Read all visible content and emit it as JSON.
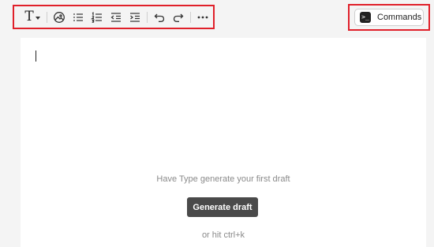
{
  "toolbar": {
    "buttons": [
      {
        "name": "text-style",
        "icon": "text-format-icon",
        "label": "T"
      },
      {
        "name": "image",
        "icon": "image-icon"
      },
      {
        "name": "bullet-list",
        "icon": "bullet-list-icon"
      },
      {
        "name": "numbered-list",
        "icon": "numbered-list-icon"
      },
      {
        "name": "outdent",
        "icon": "outdent-icon"
      },
      {
        "name": "indent",
        "icon": "indent-icon"
      },
      {
        "name": "undo",
        "icon": "undo-icon"
      },
      {
        "name": "redo",
        "icon": "redo-icon"
      },
      {
        "name": "more",
        "icon": "more-icon"
      }
    ]
  },
  "commands": {
    "label": "Commands",
    "icon": "terminal-icon"
  },
  "editor": {
    "prompt": "Have Type generate your first draft",
    "generate_label": "Generate draft",
    "shortcut_hint": "or hit ctrl+k"
  },
  "colors": {
    "highlight_border": "#e0202a",
    "primary_button": "#4a4a4a",
    "background": "#f4f4f4"
  }
}
